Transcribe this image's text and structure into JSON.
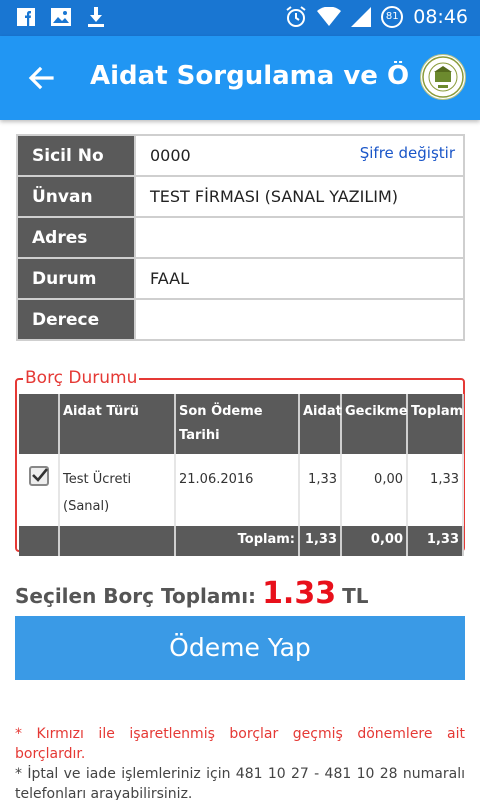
{
  "status_bar": {
    "time": "08:46",
    "battery": "81",
    "icons": [
      "facebook-icon",
      "gallery-icon",
      "download-icon",
      "alarm-icon",
      "wifi-icon",
      "signal-icon",
      "battery-icon"
    ]
  },
  "app_bar": {
    "title": "Aidat Sorgulama ve Ödeme",
    "back_icon": "arrow-back-icon",
    "logo_icon": "chamber-logo-icon"
  },
  "info": {
    "rows": [
      {
        "label": "Sicil No",
        "value": "0000"
      },
      {
        "label": "Ünvan",
        "value": "TEST FİRMASI (SANAL YAZILIM)"
      },
      {
        "label": "Adres",
        "value": ""
      },
      {
        "label": "Durum",
        "value": "FAAL"
      },
      {
        "label": "Derece",
        "value": ""
      }
    ],
    "change_password_link": "Şifre değiştir"
  },
  "borc": {
    "legend": "Borç Durumu",
    "headers": [
      "Aidat Türü",
      "Son Ödeme Tarihi",
      "Aidat",
      "Gecikme",
      "Toplam"
    ],
    "rows": [
      {
        "checked": true,
        "type": "Test Ücreti (Sanal)",
        "due_date": "21.06.2016",
        "aidat": "1,33",
        "gecikme": "0,00",
        "toplam": "1,33"
      }
    ],
    "total_label": "Toplam:",
    "total_aidat": "1,33",
    "total_gecikme": "0,00",
    "total_toplam": "1,33"
  },
  "summary": {
    "label": "Seçilen Borç Toplamı:",
    "value": "1.33",
    "currency": "TL"
  },
  "pay_button": "Ödeme Yap",
  "notes": {
    "red_note": "* Kırmızı ile işaretlenmiş borçlar geçmiş dönemlere ait borçlardır.",
    "info_note": "* İptal ve iade işlemleriniz için 481 10 27 - 481 10 28 numaralı telefonları arayabilirsiniz."
  },
  "colors": {
    "status_bar": "#1976d2",
    "app_bar": "#2196f3",
    "header_cell": "#5a5a5a",
    "accent_red": "#e53935",
    "pay_button": "#3a9ae6",
    "link": "#1a56c8"
  }
}
